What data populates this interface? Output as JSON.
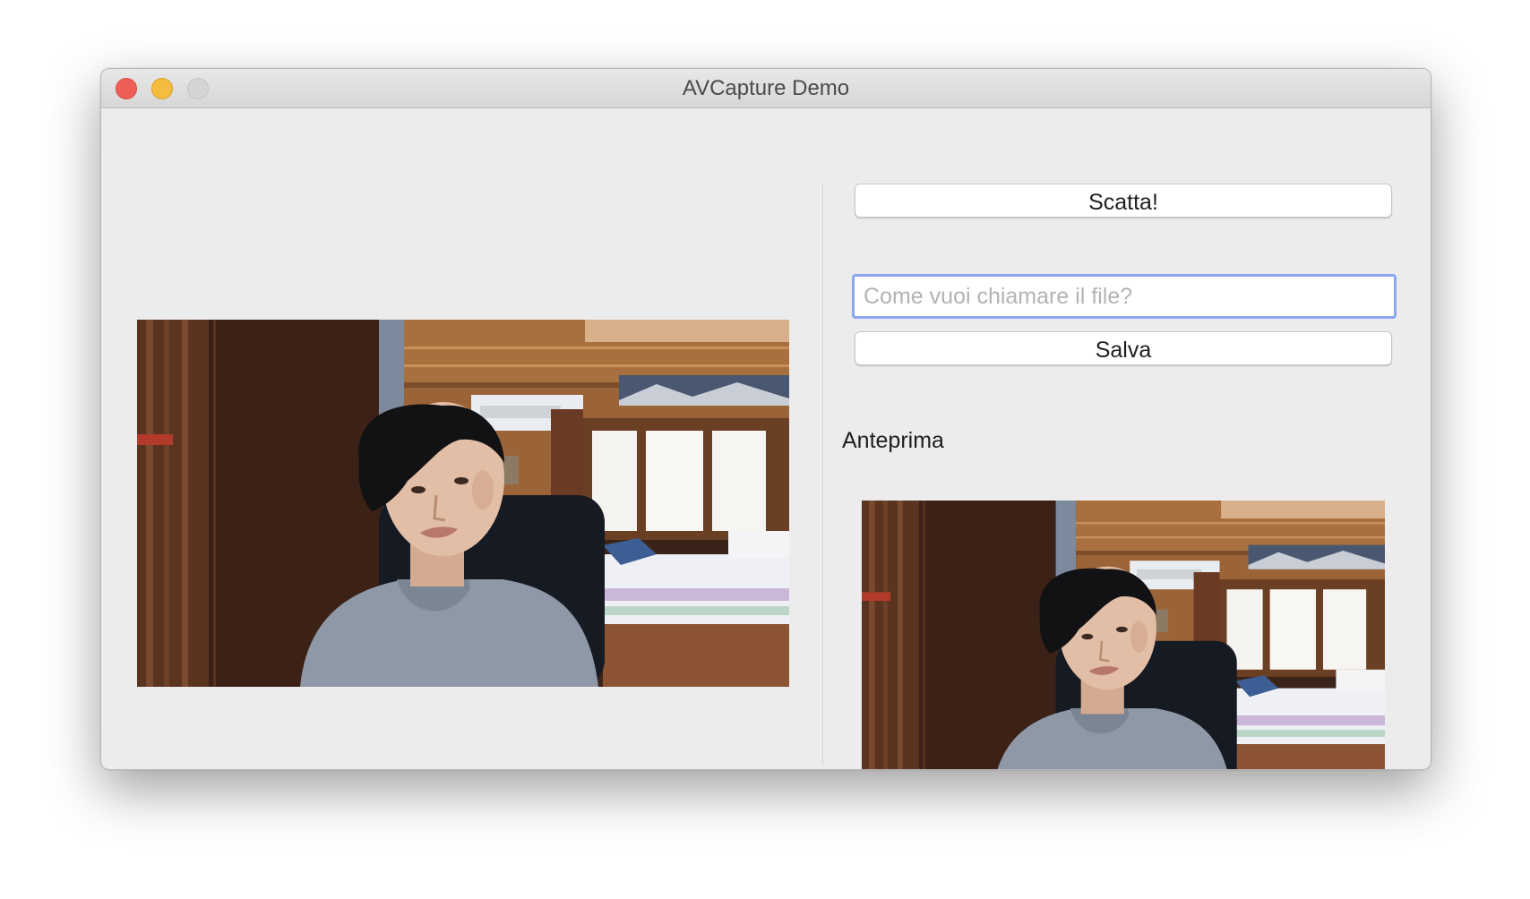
{
  "window": {
    "title": "AVCapture Demo",
    "traffic_lights": [
      "close",
      "minimize",
      "zoom"
    ]
  },
  "camera": {
    "live_view_image": "webcam-live-feed",
    "preview_image": "captured-photo-preview"
  },
  "controls": {
    "shoot_label": "Scatta!",
    "filename_value": "",
    "filename_placeholder": "Come vuoi chiamare il file?",
    "save_label": "Salva",
    "preview_label": "Anteprima"
  },
  "colors": {
    "close": "#ee5f57",
    "minimize": "#f4bd3f",
    "zoom_inactive": "#d5d5d5",
    "focus_ring": "#8aa8f0",
    "window_background": "#ececec"
  }
}
